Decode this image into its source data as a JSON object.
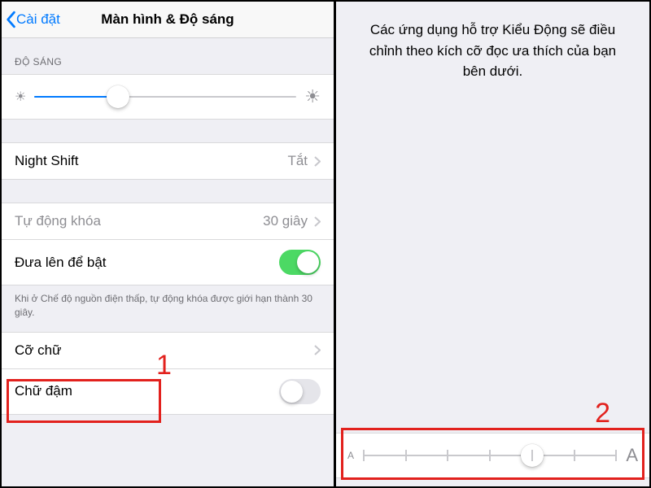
{
  "left": {
    "back_label": "Cài đặt",
    "title": "Màn hình & Độ sáng",
    "brightness_header": "ĐỘ SÁNG",
    "brightness_percent": 32,
    "night_shift": {
      "label": "Night Shift",
      "value": "Tắt"
    },
    "auto_lock": {
      "label": "Tự động khóa",
      "value": "30 giây"
    },
    "raise_to_wake": {
      "label": "Đưa lên để bật",
      "on": true
    },
    "low_power_note": "Khi ở Chế độ nguồn điện thấp, tự động khóa được giới hạn thành 30 giây.",
    "text_size": {
      "label": "Cỡ chữ"
    },
    "bold_text": {
      "label": "Chữ đậm",
      "on": false
    }
  },
  "right": {
    "description": "Các ứng dụng hỗ trợ Kiểu Động sẽ điều chỉnh theo kích cỡ đọc ưa thích của bạn bên dưới.",
    "text_size_steps": 7,
    "text_size_index": 4
  },
  "annotations": {
    "step1": "1",
    "step2": "2"
  },
  "colors": {
    "accent": "#007aff",
    "switch_on": "#4cd964",
    "annotation": "#e2211d"
  }
}
